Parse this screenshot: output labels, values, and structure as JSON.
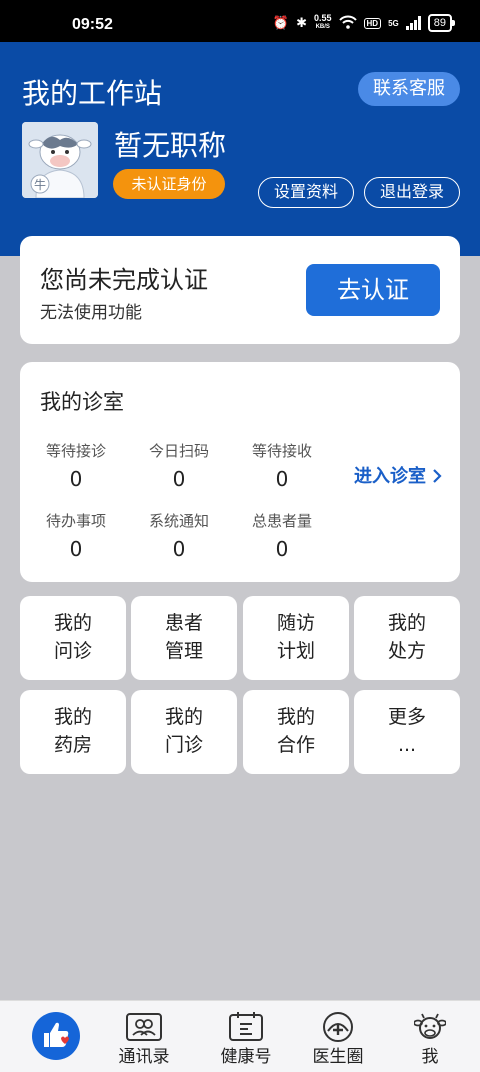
{
  "status_bar": {
    "time": "09:52",
    "net_speed_value": "0.55",
    "net_speed_unit": "KB/S",
    "hd": "HD",
    "network": "5G",
    "battery": "89"
  },
  "header": {
    "title": "我的工作站",
    "service_button": "联系客服",
    "professional_title": "暂无职称",
    "verify_badge": "未认证身份",
    "settings_button": "设置资料",
    "logout_button": "退出登录",
    "avatar_mark": "牛"
  },
  "verify_card": {
    "title": "您尚未完成认证",
    "subtitle": "无法使用功能",
    "button": "去认证"
  },
  "clinic": {
    "title": "我的诊室",
    "enter_label": "进入诊室",
    "stats": [
      {
        "label": "等待接诊",
        "value": "0"
      },
      {
        "label": "今日扫码",
        "value": "0"
      },
      {
        "label": "等待接收",
        "value": "0"
      },
      {
        "label": "待办事项",
        "value": "0"
      },
      {
        "label": "系统通知",
        "value": "0"
      },
      {
        "label": "总患者量",
        "value": "0"
      }
    ]
  },
  "grid": [
    {
      "line1": "我的",
      "line2": "问诊"
    },
    {
      "line1": "患者",
      "line2": "管理"
    },
    {
      "line1": "随访",
      "line2": "计划"
    },
    {
      "line1": "我的",
      "line2": "处方"
    },
    {
      "line1": "我的",
      "line2": "药房"
    },
    {
      "line1": "我的",
      "line2": "门诊"
    },
    {
      "line1": "我的",
      "line2": "合作"
    },
    {
      "line1": "更多",
      "line2": "..."
    }
  ],
  "tabs": [
    {
      "label": "",
      "icon": "thumbs-up-heart-icon"
    },
    {
      "label": "通讯录",
      "icon": "contacts-icon"
    },
    {
      "label": "健康号",
      "icon": "health-account-icon"
    },
    {
      "label": "医生圈",
      "icon": "doctor-circle-icon"
    },
    {
      "label": "我",
      "icon": "cow-profile-icon"
    }
  ],
  "colors": {
    "header_blue": "#0a4ba6",
    "accent_blue": "#1f6ed9",
    "badge_orange": "#f4930d"
  }
}
